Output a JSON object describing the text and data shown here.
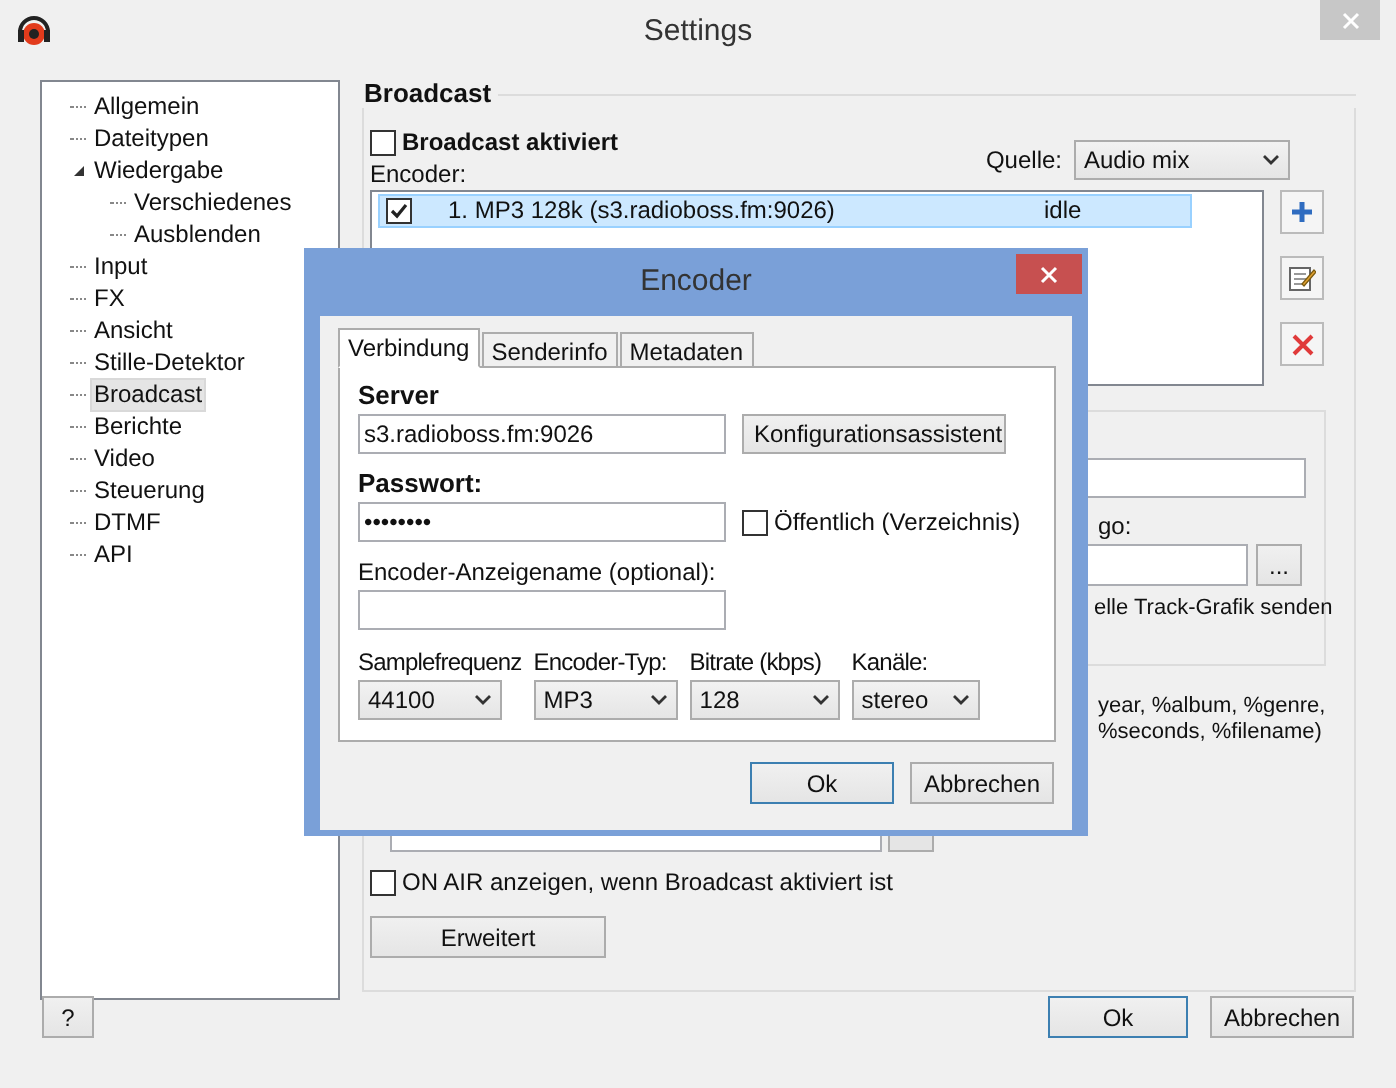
{
  "window": {
    "title": "Settings"
  },
  "tree": [
    {
      "label": "Allgemein",
      "selected": false
    },
    {
      "label": "Dateitypen",
      "selected": false
    },
    {
      "label": "Wiedergabe",
      "selected": false,
      "expanded": true,
      "children": [
        {
          "label": "Verschiedenes",
          "selected": false
        },
        {
          "label": "Ausblenden",
          "selected": false
        }
      ]
    },
    {
      "label": "Input",
      "selected": false
    },
    {
      "label": "FX",
      "selected": false
    },
    {
      "label": "Ansicht",
      "selected": false
    },
    {
      "label": "Stille-Detektor",
      "selected": false
    },
    {
      "label": "Broadcast",
      "selected": true
    },
    {
      "label": "Berichte",
      "selected": false
    },
    {
      "label": "Video",
      "selected": false
    },
    {
      "label": "Steuerung",
      "selected": false
    },
    {
      "label": "DTMF",
      "selected": false
    },
    {
      "label": "API",
      "selected": false
    }
  ],
  "broadcast": {
    "title": "Broadcast",
    "enabled": {
      "label": "Broadcast aktiviert",
      "checked": false
    },
    "encoder_label": "Encoder:",
    "source_label": "Quelle:",
    "source_value": "Audio mix",
    "encoders": [
      {
        "name": "1. MP3 128k (s3.radioboss.fm:9026)",
        "status": "idle",
        "checked": true,
        "selected": true
      }
    ],
    "logo_label": "go:",
    "logo_browse": "...",
    "track_art": "elle Track-Grafik senden",
    "vars_line_1": "year, %album, %genre,",
    "vars_line_2": "%seconds, %filename)",
    "on_air": {
      "label": "ON AIR anzeigen, wenn Broadcast aktiviert ist",
      "checked": false
    },
    "advanced_button": "Erweitert"
  },
  "buttons": {
    "help": "?",
    "ok": "Ok",
    "cancel": "Abbrechen"
  },
  "dialog": {
    "title": "Encoder",
    "tabs": [
      {
        "label": "Verbindung",
        "selected": true
      },
      {
        "label": "Senderinfo",
        "selected": false
      },
      {
        "label": "Metadaten",
        "selected": false
      }
    ],
    "server_label": "Server",
    "server": "s3.radioboss.fm:9026",
    "wizard_button": "Konfigurationsassistent",
    "password_label": "Passwort:",
    "password": "••••••••",
    "public": {
      "label": "Öffentlich (Verzeichnis)",
      "checked": false
    },
    "display_name_label": "Encoder-Anzeigename (optional):",
    "combos": [
      {
        "label": "Samplefrequenz",
        "value": "44100"
      },
      {
        "label": "Encoder-Typ:",
        "value": "MP3"
      },
      {
        "label": "Bitrate (kbps)",
        "value": "128"
      },
      {
        "label": "Kanäle:",
        "value": "stereo"
      }
    ],
    "ok": "Ok",
    "cancel": "Abbrechen"
  }
}
